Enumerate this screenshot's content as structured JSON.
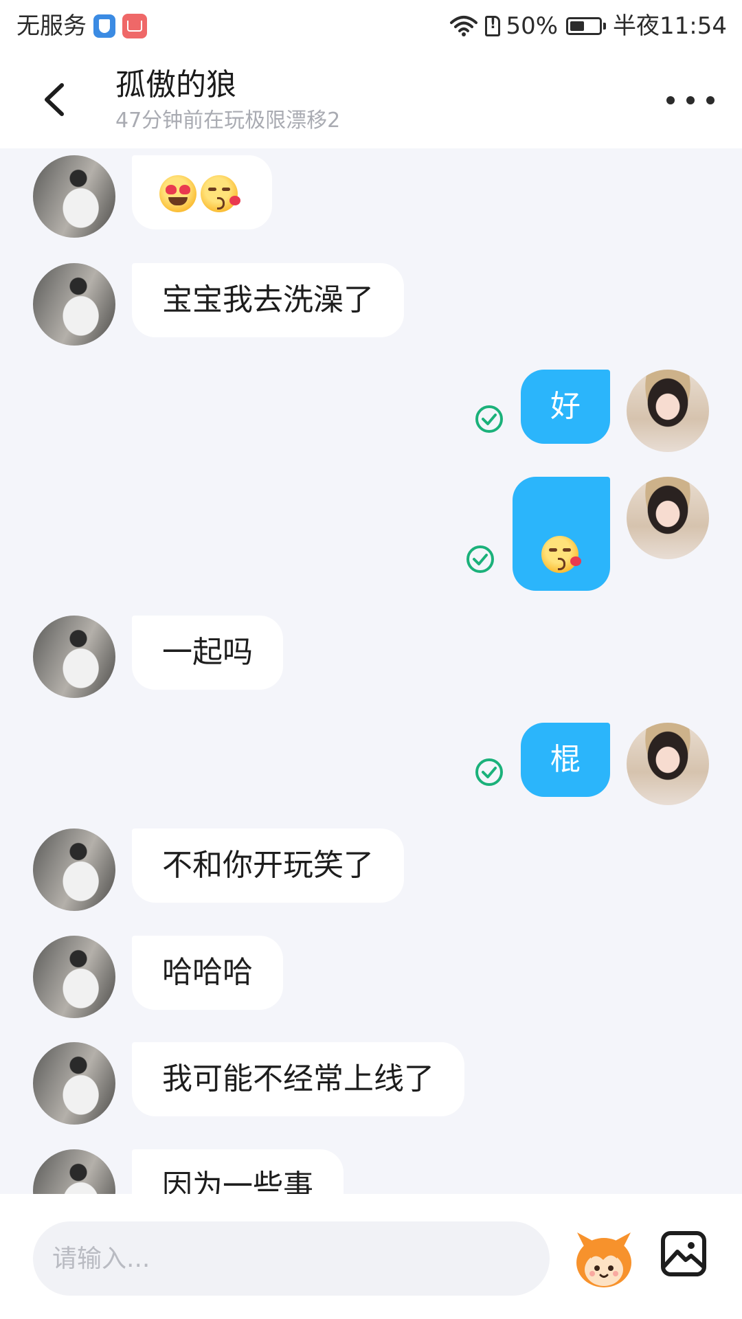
{
  "status_bar": {
    "carrier": "无服务",
    "battery": "50%",
    "battery_level": 0.5,
    "time": "半夜11:54",
    "icons": [
      "shield-icon",
      "app-store-icon",
      "wifi-icon",
      "sim-alert-icon",
      "battery-icon"
    ]
  },
  "header": {
    "title": "孤傲的狼",
    "subtitle": "47分钟前在玩极限漂移2",
    "icons": {
      "back": "back-arrow-icon",
      "more": "more-dots-icon"
    }
  },
  "messages": [
    {
      "sender": "other",
      "text": "",
      "emoji": [
        "heart-eyes-emoji",
        "kiss-emoji"
      ]
    },
    {
      "sender": "other",
      "text": "宝宝我去洗澡了"
    },
    {
      "sender": "me",
      "text": "好",
      "read": true
    },
    {
      "sender": "me",
      "text": "",
      "emoji": [
        "kiss-emoji"
      ],
      "read": true
    },
    {
      "sender": "other",
      "text": "一起吗"
    },
    {
      "sender": "me",
      "text": "棍",
      "read": true
    },
    {
      "sender": "other",
      "text": "不和你开玩笑了"
    },
    {
      "sender": "other",
      "text": "哈哈哈"
    },
    {
      "sender": "other",
      "text": "我可能不经常上线了"
    },
    {
      "sender": "other",
      "text": "因为一些事"
    }
  ],
  "input": {
    "placeholder": "请输入..."
  },
  "colors": {
    "my_bubble": "#2bb5fb",
    "other_bubble": "#ffffff",
    "chat_background": "#f4f5fa",
    "read_check": "#1bb17a"
  }
}
